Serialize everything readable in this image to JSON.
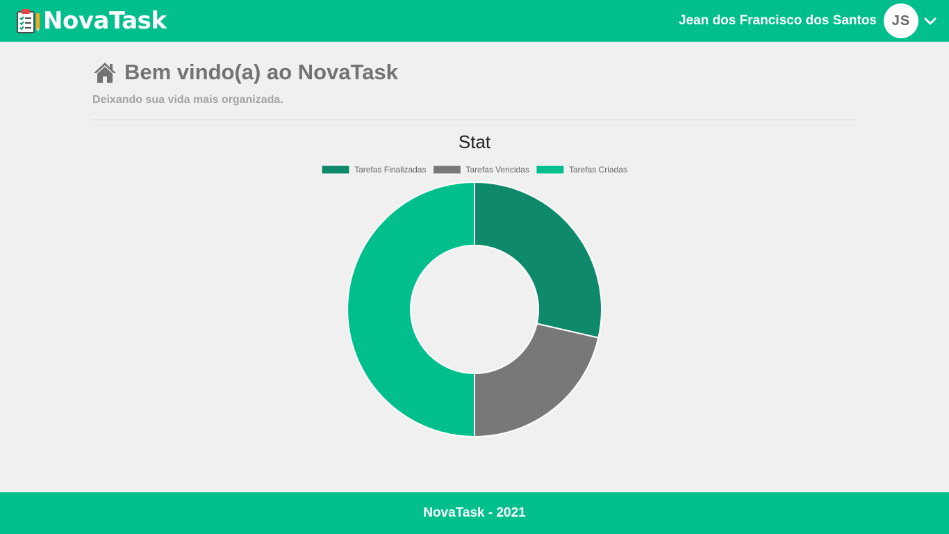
{
  "header": {
    "brand_name": "NovaTask",
    "brand_icon": "task-clipboard-icon",
    "user_name": "Jean dos Francisco dos Santos",
    "user_initials": "JS",
    "menu_icon": "chevron-down-icon"
  },
  "main": {
    "title": "Bem vindo(a) ao NovaTask",
    "title_icon": "home-icon",
    "subtitle": "Deixando sua vida mais organizada."
  },
  "chart_data": {
    "type": "doughnut",
    "title": "Stat",
    "legend_position": "top",
    "series": [
      {
        "name": "Tarefas Finalizadas",
        "value": 2,
        "color": "#0e8a6a"
      },
      {
        "name": "Tarefas Vencidas",
        "value": 1.5,
        "color": "#787878"
      },
      {
        "name": "Tarefas Criadas",
        "value": 3.5,
        "color": "#00bf8c"
      }
    ]
  },
  "footer": {
    "text": "NovaTask - 2021"
  },
  "colors": {
    "brand": "#00bf8c",
    "background": "#f0f0f0"
  }
}
